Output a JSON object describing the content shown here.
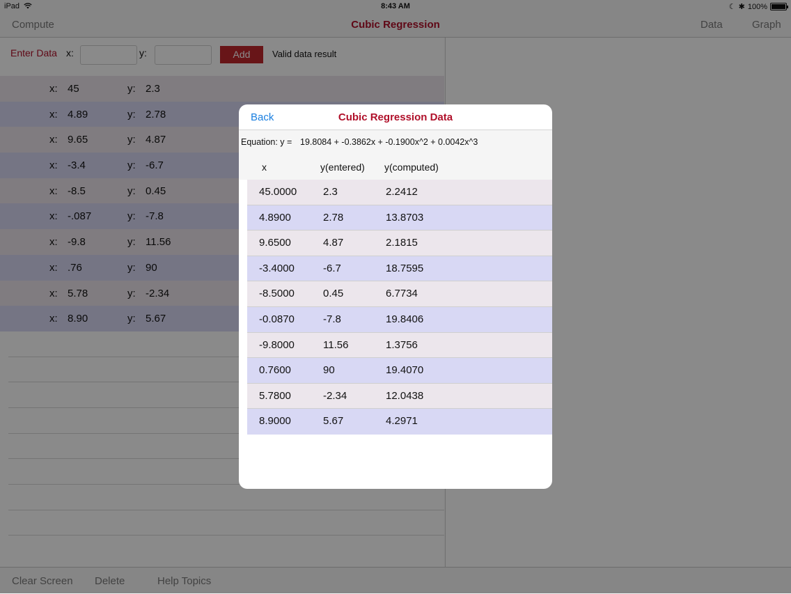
{
  "status_bar": {
    "device": "iPad",
    "time": "8:43 AM",
    "battery": "100%"
  },
  "nav": {
    "compute": "Compute",
    "title": "Cubic Regression",
    "data": "Data",
    "graph": "Graph"
  },
  "entry": {
    "label": "Enter Data",
    "x_label": "x:",
    "y_label": "y:",
    "x_value": "",
    "y_value": "",
    "add": "Add",
    "result": "Valid data result"
  },
  "data_rows": [
    {
      "xl": "x:",
      "x": "45",
      "yl": "y:",
      "y": "2.3"
    },
    {
      "xl": "x:",
      "x": "4.89",
      "yl": "y:",
      "y": "2.78"
    },
    {
      "xl": "x:",
      "x": "9.65",
      "yl": "y:",
      "y": "4.87"
    },
    {
      "xl": "x:",
      "x": "-3.4",
      "yl": "y:",
      "y": "-6.7"
    },
    {
      "xl": "x:",
      "x": "-8.5",
      "yl": "y:",
      "y": "0.45"
    },
    {
      "xl": "x:",
      "x": "-.087",
      "yl": "y:",
      "y": "-7.8"
    },
    {
      "xl": "x:",
      "x": "-9.8",
      "yl": "y:",
      "y": "11.56"
    },
    {
      "xl": "x:",
      "x": ".76",
      "yl": "y:",
      "y": "90"
    },
    {
      "xl": "x:",
      "x": "5.78",
      "yl": "y:",
      "y": "-2.34"
    },
    {
      "xl": "x:",
      "x": "8.90",
      "yl": "y:",
      "y": "5.67"
    }
  ],
  "toolbar": {
    "clear": "Clear Screen",
    "delete": "Delete",
    "help": "Help Topics"
  },
  "modal": {
    "back": "Back",
    "title": "Cubic Regression Data",
    "equation_label": "Equation: y =",
    "equation": "19.8084 + -0.3862x + -0.1900x^2 + 0.0042x^3",
    "headers": {
      "x": "x",
      "y_entered": "y(entered)",
      "y_computed": "y(computed)"
    },
    "rows": [
      {
        "x": "45.0000",
        "ye": "2.3",
        "yc": "2.2412"
      },
      {
        "x": "4.8900",
        "ye": "2.78",
        "yc": "13.8703"
      },
      {
        "x": "9.6500",
        "ye": "4.87",
        "yc": "2.1815"
      },
      {
        "x": "-3.4000",
        "ye": "-6.7",
        "yc": "18.7595"
      },
      {
        "x": "-8.5000",
        "ye": "0.45",
        "yc": "6.7734"
      },
      {
        "x": "-0.0870",
        "ye": "-7.8",
        "yc": "19.8406"
      },
      {
        "x": "-9.8000",
        "ye": "11.56",
        "yc": "1.3756"
      },
      {
        "x": "0.7600",
        "ye": "90",
        "yc": "19.4070"
      },
      {
        "x": "5.7800",
        "ye": "-2.34",
        "yc": "12.0438"
      },
      {
        "x": "8.9000",
        "ye": "5.67",
        "yc": "4.2971"
      }
    ]
  },
  "colors": {
    "accent": "#b0102a",
    "add_button": "#c1272d",
    "link": "#1a7fe0",
    "row_odd": "#ece6ec",
    "row_even": "#d8d8f4"
  }
}
